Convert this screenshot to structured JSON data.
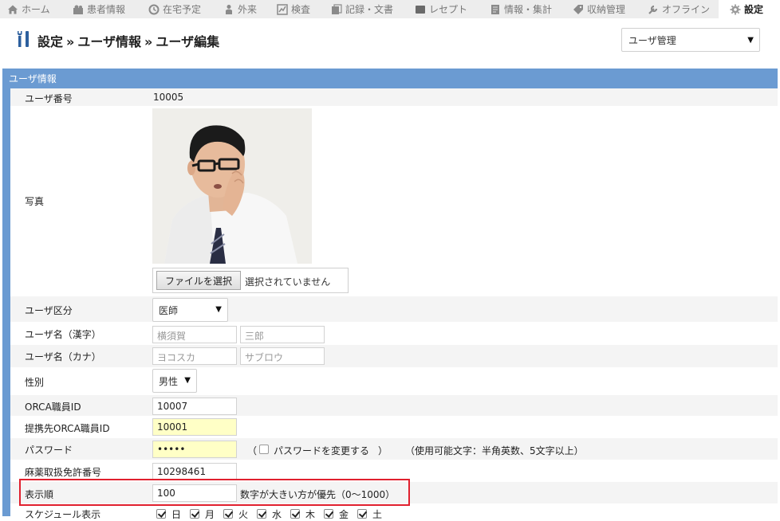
{
  "nav": {
    "items": [
      {
        "label": "ホーム",
        "icon": "home-icon"
      },
      {
        "label": "患者情報",
        "icon": "patients-icon"
      },
      {
        "label": "在宅予定",
        "icon": "clock-icon"
      },
      {
        "label": "外来",
        "icon": "person-icon"
      },
      {
        "label": "検査",
        "icon": "chart-icon"
      },
      {
        "label": "記録・文書",
        "icon": "documents-icon"
      },
      {
        "label": "レセプト",
        "icon": "receipt-icon"
      },
      {
        "label": "情報・集計",
        "icon": "report-icon"
      },
      {
        "label": "収納管理",
        "icon": "tag-icon"
      },
      {
        "label": "オフライン",
        "icon": "wrench-icon"
      },
      {
        "label": "設定",
        "icon": "gear-icon"
      }
    ],
    "active_index": 10
  },
  "header": {
    "breadcrumb": [
      "設定",
      "ユーザ情報",
      "ユーザ編集"
    ],
    "separator": "»",
    "menu_select": "ユーザ管理"
  },
  "panel": {
    "title": "ユーザ情報",
    "user_number": {
      "label": "ユーザ番号",
      "value": "10005"
    },
    "photo": {
      "label": "写真",
      "file_button": "ファイルを選択",
      "file_status": "選択されていません"
    },
    "user_type": {
      "label": "ユーザ区分",
      "value": "医師"
    },
    "name_kanji": {
      "label": "ユーザ名（漢字）",
      "last": "横須賀",
      "first": "三郎"
    },
    "name_kana": {
      "label": "ユーザ名（カナ）",
      "last": "ヨコスカ",
      "first": "サブロウ"
    },
    "gender": {
      "label": "性別",
      "value": "男性"
    },
    "orca_id": {
      "label": "ORCA職員ID",
      "value": "10007"
    },
    "partner_orca_id": {
      "label": "提携先ORCA職員ID",
      "value": "10001"
    },
    "password": {
      "label": "パスワード",
      "value": "•••••",
      "open_paren": "（",
      "change_label": "パスワードを変更する",
      "close_paren": "）",
      "hint": "（使用可能文字：半角英数、5文字以上）",
      "change_checked": false
    },
    "narcotic_license": {
      "label": "麻薬取扱免許番号",
      "value": "10298461"
    },
    "display_order": {
      "label": "表示順",
      "value": "100",
      "hint": "数字が大きい方が優先（0〜1000）"
    },
    "schedule": {
      "label": "スケジュール表示",
      "days": [
        "日",
        "月",
        "火",
        "水",
        "木",
        "金",
        "土"
      ],
      "checked": [
        true,
        true,
        true,
        true,
        true,
        true,
        true
      ]
    }
  },
  "colors": {
    "panel": "#6b9bd2",
    "highlight": "#e0202e",
    "yellow_field": "#ffffc6",
    "nav_bg": "#ededed"
  }
}
